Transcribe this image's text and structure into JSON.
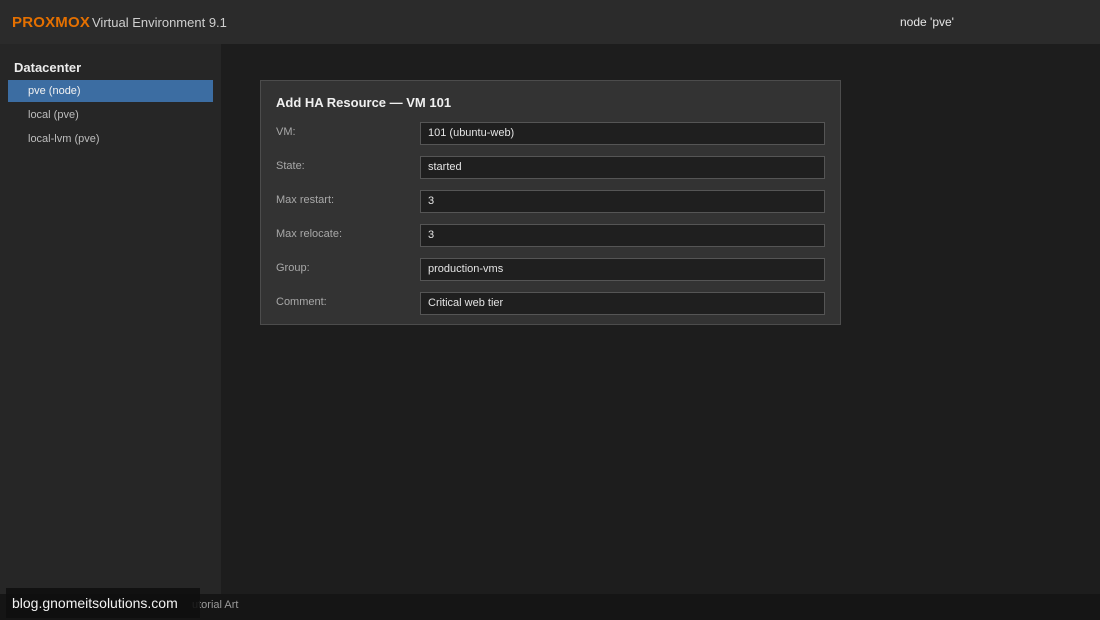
{
  "header": {
    "brand": "PROXMOX",
    "subtitle": "Virtual Environment 9.1",
    "node": "node 'pve'"
  },
  "sidebar": {
    "title": "Datacenter",
    "items": [
      {
        "label": "pve (node)",
        "selected": true
      },
      {
        "label": "local (pve)",
        "selected": false
      },
      {
        "label": "local-lvm (pve)",
        "selected": false
      }
    ]
  },
  "dialog": {
    "title": "Add HA Resource — VM 101",
    "fields": [
      {
        "label": "VM:",
        "value": "101 (ubuntu-web)"
      },
      {
        "label": "State:",
        "value": "started"
      },
      {
        "label": "Max restart:",
        "value": "3"
      },
      {
        "label": "Max relocate:",
        "value": "3"
      },
      {
        "label": "Group:",
        "value": "production-vms"
      },
      {
        "label": "Comment:",
        "value": "Critical web tier"
      }
    ]
  },
  "footer": {
    "text": "utorial Art"
  },
  "watermark": {
    "text": "blog.gnomeitsolutions.com"
  },
  "colors": {
    "accent": "#e57000",
    "selection": "#3c6da2"
  }
}
